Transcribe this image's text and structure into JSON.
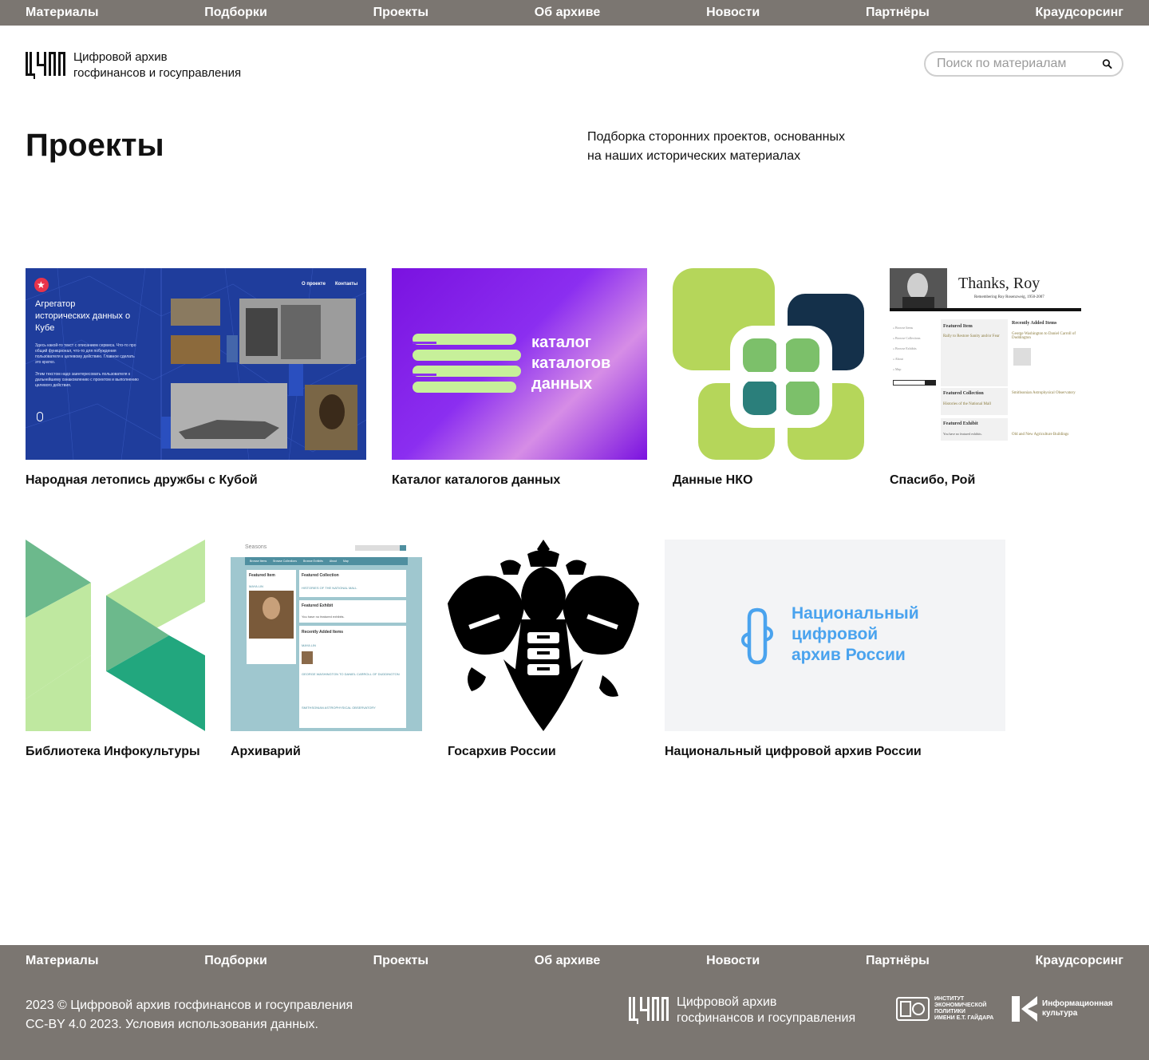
{
  "nav": {
    "items": [
      "Материалы",
      "Подборки",
      "Проекты",
      "Об архиве",
      "Новости",
      "Партнёры",
      "Краудсорсинг"
    ]
  },
  "header": {
    "logo_line1": "Цифровой архив",
    "logo_line2": "госфинансов и госуправления",
    "search_placeholder": "Поиск по материалам"
  },
  "page": {
    "title": "Проекты",
    "description_line1": "Подборка сторонних проектов, основанных",
    "description_line2": "на наших исторических материалах"
  },
  "projects": [
    {
      "title": "Народная летопись дружбы с Кубой",
      "thumb": {
        "heading": "Агрегатор исторических данных о Кубе",
        "body": "Здесь какой-то текст с описанием сервиса. Что-то про общий функционал, что-то для побуждения пользователя к целевому действию. Главное сделать это кратко.",
        "body2": "Этим текстом надо заинтересовать пользователя к дальнейшему ознакомлению с проектом и выполнению целевого действия.",
        "link1": "О проекте",
        "link2": "Контакты"
      }
    },
    {
      "title": "Каталог каталогов данных",
      "thumb": {
        "line1": "каталог",
        "line2": "каталогов",
        "line3": "данных"
      }
    },
    {
      "title": "Данные НКО"
    },
    {
      "title": "Спасибо, Рой",
      "thumb": {
        "heading": "Thanks, Roy",
        "subheading": "Remembering Roy Rosenzweig, 1950-2007",
        "nav": [
          "» Browse Items",
          "» Browse Collections",
          "» Browse Exhibits",
          "» About",
          "» Map"
        ],
        "featured_item": "Featured Item",
        "featured_item_link": "Rally to Restore Sanity and/or Fear",
        "featured_collection": "Featured Collection",
        "featured_collection_link": "Histories of the National Mall",
        "featured_exhibit": "Featured Exhibit",
        "featured_exhibit_text": "You have no featured exhibits.",
        "recent": "Recently Added Items",
        "recent1": "George Washington to Daniel Carroll of Duddington",
        "recent2": "Smithsonian Astrophysical Observatory",
        "recent3": "Old and New Agriculture Buildings"
      }
    },
    {
      "title": "Библиотека Инфокультуры"
    },
    {
      "title": "Архиварий",
      "thumb": {
        "site": "Seasons",
        "tabs": [
          "Browse Items",
          "Browse Collections",
          "Browse Exhibits",
          "About",
          "Map"
        ],
        "featured_item": "Featured Item",
        "person": "MAYA LIN",
        "featured_collection": "Featured Collection",
        "collection_link": "HISTORIES OF THE NATIONAL MALL",
        "featured_exhibit": "Featured Exhibit",
        "exhibit_text": "You have no featured exhibits.",
        "recent": "Recently Added Items",
        "recent1": "MAYA LIN",
        "recent2": "GEORGE WASHINGTON TO DANIEL CARROLL OF DUDDINGTON",
        "recent3": "SMITHSONIAN ASTROPHYSICAL OBSERVATORY"
      }
    },
    {
      "title": "Госархив России"
    },
    {
      "title": "Национальный цифровой архив России",
      "thumb": {
        "line1": "Национальный",
        "line2": "цифровой",
        "line3": "архив России"
      }
    }
  ],
  "footer": {
    "copyright_line1": "2023 © Цифровой архив госфинансов и госуправления",
    "copyright_line2": "CC-BY 4.0 2023. Условия использования данных.",
    "logo_line1": "Цифровой архив",
    "logo_line2": "госфинансов и госуправления",
    "partner1_lines": [
      "Институт",
      "экономической",
      "политики",
      "имени Е.Т. Гайдара"
    ],
    "partner2_lines": [
      "Информационная",
      "культура"
    ]
  },
  "colors": {
    "nav_bg": "#7b7671",
    "cuba_blue": "#1f3d9c",
    "catalog_purple": "#7a12e0",
    "nko_green": "#b5d65a",
    "nko_navy": "#14304a",
    "infoculture_green": "#22a77e",
    "archive_blue": "#4aa3ee"
  }
}
